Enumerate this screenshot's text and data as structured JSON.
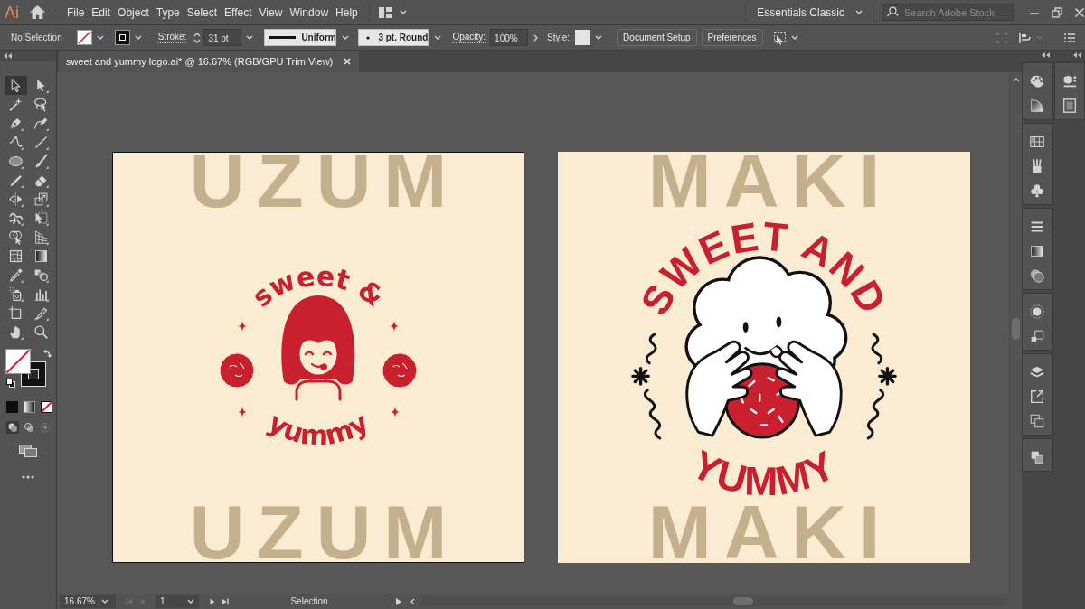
{
  "app": {
    "logo": "Ai"
  },
  "menu": [
    "File",
    "Edit",
    "Object",
    "Type",
    "Select",
    "Effect",
    "View",
    "Window",
    "Help"
  ],
  "workspace": {
    "label": "Essentials Classic"
  },
  "search": {
    "placeholder": "Search Adobe Stock"
  },
  "control_bar": {
    "selection": "No Selection",
    "stroke_label": "Stroke:",
    "stroke_weight": "31 pt",
    "stroke_profile": "Uniform",
    "brush": "3 pt. Round",
    "opacity_label": "Opacity:",
    "opacity": "100%",
    "style_label": "Style:",
    "buttons": [
      "Document Setup",
      "Preferences"
    ]
  },
  "tabs": [
    {
      "label": "sweet and yummy logo.ai* @ 16.67% (RGB/GPU Trim View)",
      "selected": true
    }
  ],
  "tools": [
    {
      "selected": true
    },
    {
      "selected": false
    },
    {
      "selected": false
    },
    {
      "selected": false
    },
    {
      "selected": false
    },
    {
      "selected": false
    },
    {
      "selected": false
    },
    {
      "selected": false
    },
    {
      "selected": false
    },
    {
      "selected": false
    },
    {
      "selected": false
    },
    {
      "selected": false
    },
    {
      "selected": false
    },
    {
      "selected": false
    },
    {
      "selected": false
    },
    {
      "selected": false
    },
    {
      "selected": false
    },
    {
      "selected": false
    },
    {
      "selected": false
    },
    {
      "selected": false
    },
    {
      "selected": false
    },
    {
      "selected": false
    },
    {
      "selected": false
    },
    {
      "selected": false
    },
    {
      "selected": false
    },
    {
      "selected": false
    },
    {
      "selected": false
    },
    {
      "selected": false
    }
  ],
  "artboards": [
    {
      "selected": true,
      "background_text": [
        "UZUM",
        "UZUM"
      ],
      "logo": {
        "kind": "girl",
        "top_text": "sweet &",
        "bottom_text": "yummy"
      }
    },
    {
      "selected": false,
      "background_text": [
        "MAKI",
        "MAKI"
      ],
      "logo": {
        "kind": "cloud",
        "top_text": "SWEET AND",
        "bottom_text": "YUMMY"
      }
    }
  ],
  "status_bar": {
    "zoom": "16.67%",
    "page_nav": [
      {
        "disabled": true
      },
      {
        "disabled": true
      },
      {
        "disabled": false
      },
      {
        "disabled": false
      }
    ],
    "artboard": "1",
    "tool": "Selection"
  }
}
